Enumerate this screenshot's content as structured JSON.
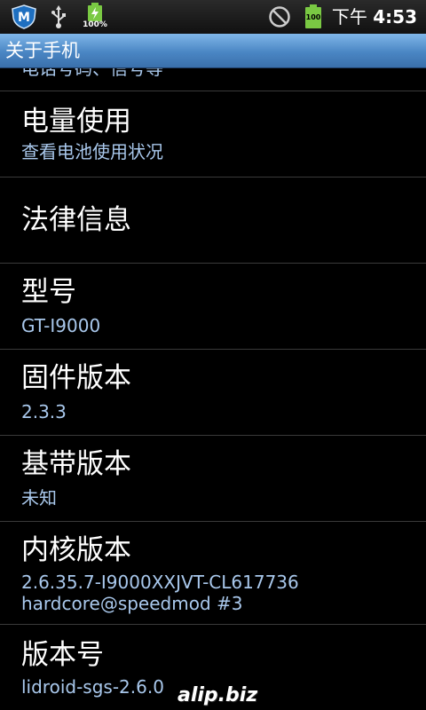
{
  "status_bar": {
    "battery_left_text": "100%",
    "battery_right_text": "100",
    "time_prefix": "下午",
    "time": "4:53",
    "icons": [
      "shield-m-icon",
      "usb-icon",
      "battery-charging-icon",
      "no-signal-icon",
      "battery-icon"
    ]
  },
  "title_bar": {
    "title": "关于手机"
  },
  "list": {
    "partial_top_summary": "电话号码、信号等",
    "items": [
      {
        "title": "电量使用",
        "summary": "查看电池使用状况"
      },
      {
        "title": "法律信息"
      },
      {
        "title": "型号",
        "summary": "GT-I9000"
      },
      {
        "title": "固件版本",
        "summary": "2.3.3"
      },
      {
        "title": "基带版本",
        "summary": "未知"
      },
      {
        "title": "内核版本",
        "summary": "2.6.35.7-I9000XXJVT-CL617736",
        "summary2": "hardcore@speedmod #3"
      },
      {
        "title": "版本号",
        "summary": "lidroid-sgs-2.6.0"
      }
    ]
  },
  "watermark": "alip.biz",
  "colors": {
    "accent_blue": "#4a86c4",
    "summary_text": "#a9c8ec",
    "battery_green": "#7ac943"
  }
}
